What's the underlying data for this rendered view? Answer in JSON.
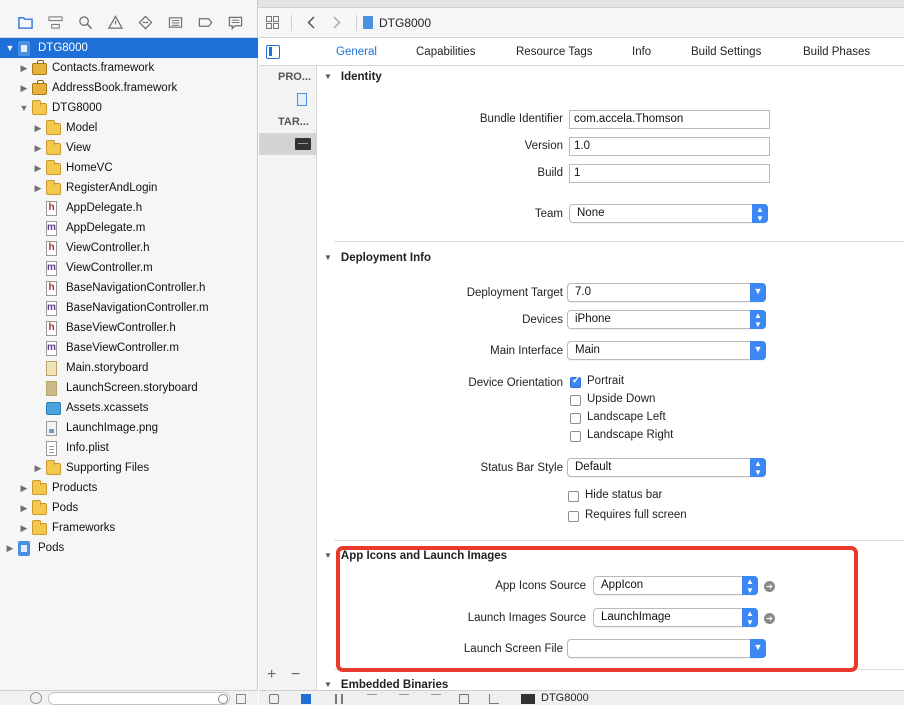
{
  "navigator": {
    "tree": [
      {
        "label": "DTG8000",
        "kind": "proj",
        "level": 0,
        "disclosure": "open",
        "selected": true
      },
      {
        "label": "Contacts.framework",
        "kind": "fw",
        "level": 1,
        "disclosure": "closed"
      },
      {
        "label": "AddressBook.framework",
        "kind": "fw",
        "level": 1,
        "disclosure": "closed"
      },
      {
        "label": "DTG8000",
        "kind": "folder",
        "level": 1,
        "disclosure": "open"
      },
      {
        "label": "Model",
        "kind": "folder",
        "level": 2,
        "disclosure": "closed"
      },
      {
        "label": "View",
        "kind": "folder",
        "level": 2,
        "disclosure": "closed"
      },
      {
        "label": "HomeVC",
        "kind": "folder",
        "level": 2,
        "disclosure": "closed"
      },
      {
        "label": "RegisterAndLogin",
        "kind": "folder",
        "level": 2,
        "disclosure": "closed"
      },
      {
        "label": "AppDelegate.h",
        "kind": "h",
        "level": 2
      },
      {
        "label": "AppDelegate.m",
        "kind": "m",
        "level": 2
      },
      {
        "label": "ViewController.h",
        "kind": "h",
        "level": 2
      },
      {
        "label": "ViewController.m",
        "kind": "m",
        "level": 2
      },
      {
        "label": "BaseNavigationController.h",
        "kind": "h",
        "level": 2
      },
      {
        "label": "BaseNavigationController.m",
        "kind": "m",
        "level": 2
      },
      {
        "label": "BaseViewController.h",
        "kind": "h",
        "level": 2
      },
      {
        "label": "BaseViewController.m",
        "kind": "m",
        "level": 2
      },
      {
        "label": "Main.storyboard",
        "kind": "storyboard",
        "level": 2
      },
      {
        "label": "LaunchScreen.storyboard",
        "kind": "storyboard-dark",
        "level": 2
      },
      {
        "label": "Assets.xcassets",
        "kind": "assets",
        "level": 2
      },
      {
        "label": "LaunchImage.png",
        "kind": "png",
        "level": 2
      },
      {
        "label": "Info.plist",
        "kind": "plist",
        "level": 2
      },
      {
        "label": "Supporting Files",
        "kind": "folder",
        "level": 2,
        "disclosure": "closed"
      },
      {
        "label": "Products",
        "kind": "folder",
        "level": 1,
        "disclosure": "closed"
      },
      {
        "label": "Pods",
        "kind": "folder",
        "level": 1,
        "disclosure": "closed"
      },
      {
        "label": "Frameworks",
        "kind": "folder",
        "level": 1,
        "disclosure": "closed"
      },
      {
        "label": "Pods",
        "kind": "proj",
        "level": 0,
        "disclosure": "closed"
      }
    ],
    "toolbar_icons": [
      "folder-icon",
      "hierarchy-icon",
      "search-icon",
      "warning-icon",
      "test-icon",
      "debug-icon",
      "breakpoint-icon",
      "report-icon"
    ]
  },
  "jumpbar": {
    "file": "DTG8000"
  },
  "tabs": [
    "General",
    "Capabilities",
    "Resource Tags",
    "Info",
    "Build Settings",
    "Build Phases"
  ],
  "targets": {
    "project_header": "PRO...",
    "targets_header": "TAR..."
  },
  "identity": {
    "title": "Identity",
    "bundle_identifier_label": "Bundle Identifier",
    "bundle_identifier": "com.accela.Thomson",
    "version_label": "Version",
    "version": "1.0",
    "build_label": "Build",
    "build": "1",
    "team_label": "Team",
    "team": "None"
  },
  "deployment": {
    "title": "Deployment Info",
    "target_label": "Deployment Target",
    "target": "7.0",
    "devices_label": "Devices",
    "devices": "iPhone",
    "main_interface_label": "Main Interface",
    "main_interface": "Main",
    "orientation_label": "Device Orientation",
    "orientations": [
      {
        "label": "Portrait",
        "checked": true
      },
      {
        "label": "Upside Down",
        "checked": false
      },
      {
        "label": "Landscape Left",
        "checked": false
      },
      {
        "label": "Landscape Right",
        "checked": false
      }
    ],
    "status_bar_label": "Status Bar Style",
    "status_bar": "Default",
    "hide_status_bar": "Hide status bar",
    "requires_full_screen": "Requires full screen"
  },
  "app_icons": {
    "title": "App Icons and Launch Images",
    "icons_source_label": "App Icons Source",
    "icons_source": "AppIcon",
    "launch_images_label": "Launch Images Source",
    "launch_images": "LaunchImage",
    "launch_screen_label": "Launch Screen File",
    "launch_screen": ""
  },
  "embedded": {
    "title": "Embedded Binaries"
  },
  "debugbar": {
    "scheme": "DTG8000"
  },
  "colors": {
    "accent": "#1f6fd8",
    "highlight": "#e8392a"
  }
}
